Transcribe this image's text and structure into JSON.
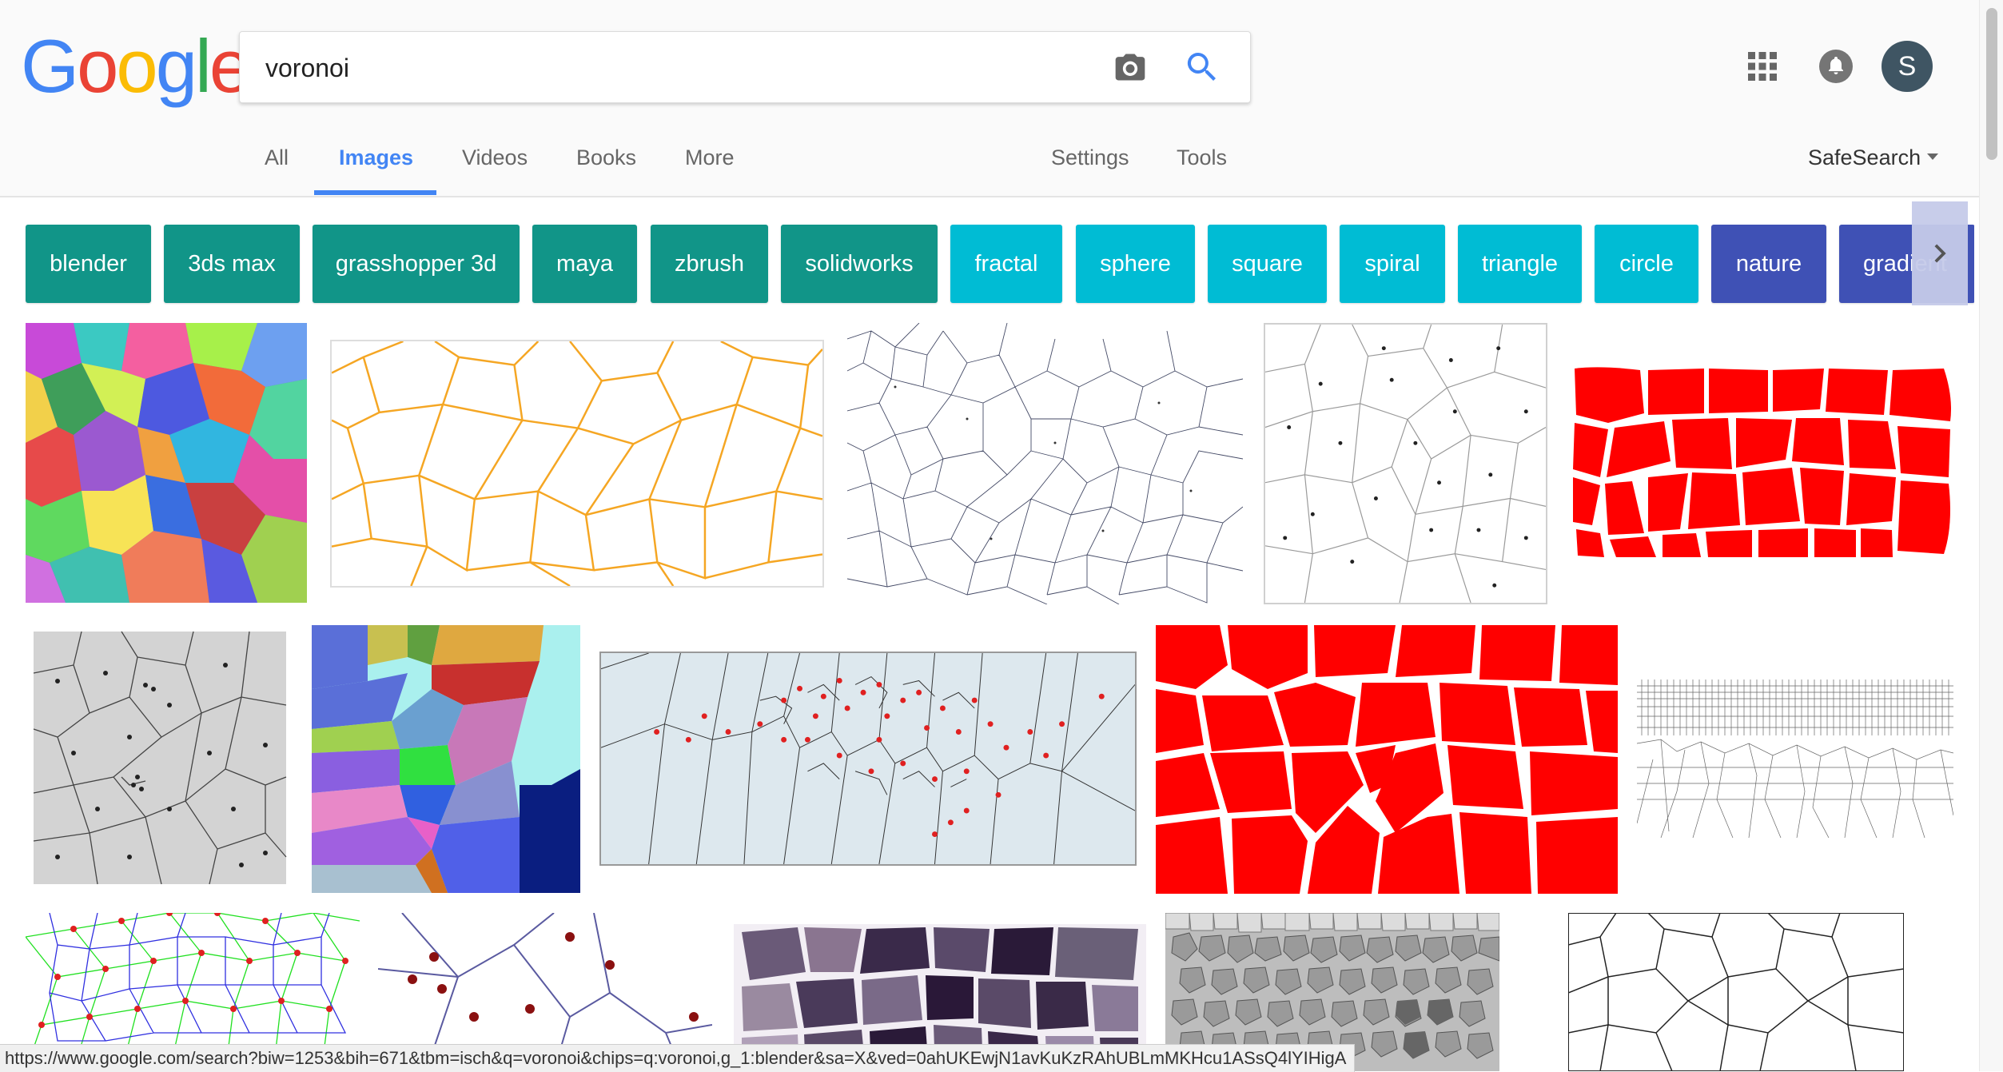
{
  "logo": {
    "letters": [
      "G",
      "o",
      "o",
      "g",
      "l",
      "e"
    ],
    "colors": [
      "#4285f4",
      "#ea4335",
      "#fbbc05",
      "#4285f4",
      "#34a853",
      "#ea4335"
    ]
  },
  "search": {
    "query": "voronoi",
    "camera_icon": "camera-icon",
    "search_icon": "search-icon"
  },
  "header_icons": {
    "apps": "apps-grid-icon",
    "notifications": "bell-icon",
    "avatar_letter": "S",
    "avatar_color": "#3f5563"
  },
  "tabs": [
    {
      "label": "All",
      "active": false
    },
    {
      "label": "Images",
      "active": true
    },
    {
      "label": "Videos",
      "active": false
    },
    {
      "label": "Books",
      "active": false
    },
    {
      "label": "More",
      "active": false
    },
    {
      "label": "Settings",
      "active": false
    },
    {
      "label": "Tools",
      "active": false
    }
  ],
  "safesearch": {
    "label": "SafeSearch"
  },
  "chips": [
    {
      "label": "blender",
      "color": "teal"
    },
    {
      "label": "3ds max",
      "color": "teal"
    },
    {
      "label": "grasshopper 3d",
      "color": "teal"
    },
    {
      "label": "maya",
      "color": "teal"
    },
    {
      "label": "zbrush",
      "color": "teal"
    },
    {
      "label": "solidworks",
      "color": "teal"
    },
    {
      "label": "fractal",
      "color": "cyan"
    },
    {
      "label": "sphere",
      "color": "cyan"
    },
    {
      "label": "square",
      "color": "cyan"
    },
    {
      "label": "spiral",
      "color": "cyan"
    },
    {
      "label": "triangle",
      "color": "cyan"
    },
    {
      "label": "circle",
      "color": "cyan"
    },
    {
      "label": "nature",
      "color": "indigo"
    },
    {
      "label": "gradient",
      "color": "indigo"
    }
  ],
  "colors": {
    "accent": "#4285f4",
    "teal": "#119588",
    "cyan": "#00bcd4",
    "indigo": "#3f51b5"
  },
  "status_url": "https://www.google.com/search?biw=1253&bih=671&tbm=isch&q=voronoi&chips=q:voronoi,g_1:blender&sa=X&ved=0ahUKEwjN1avKuKzRAhUBLmMKHcu1ASsQ4lYIHigA"
}
